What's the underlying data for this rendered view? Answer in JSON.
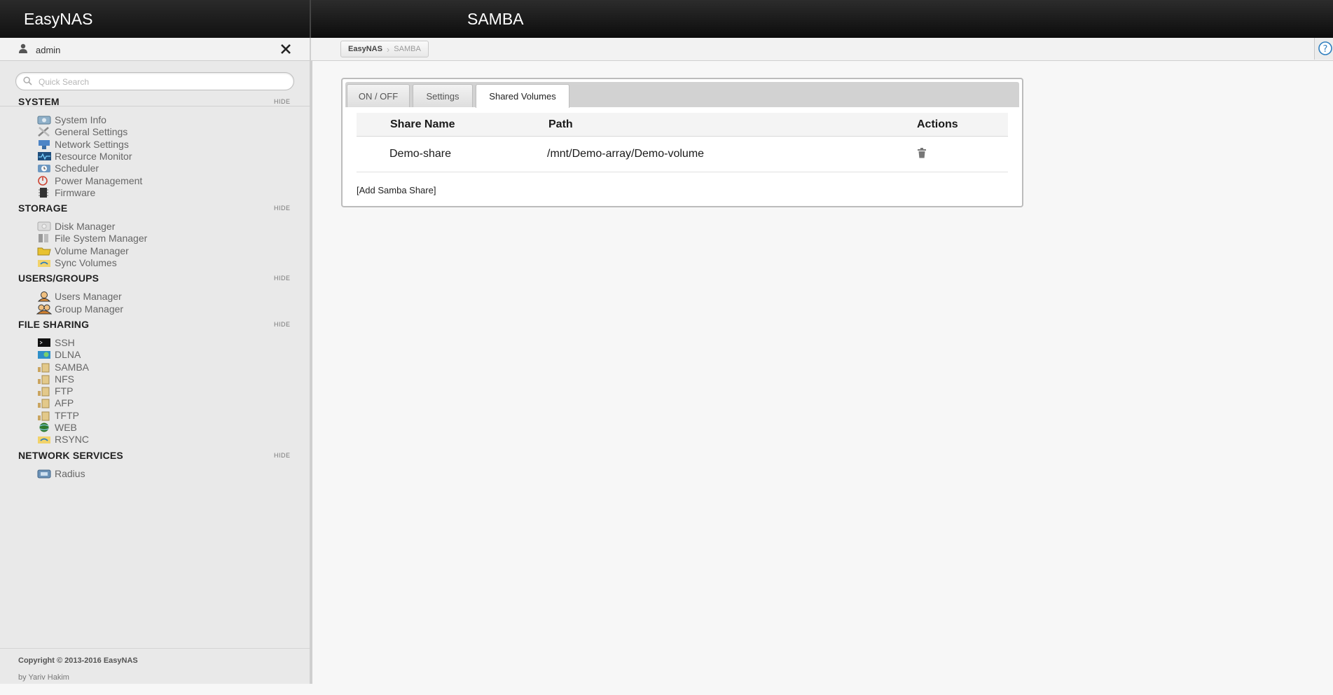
{
  "app": {
    "brand": "EasyNAS",
    "page_title": "SAMBA"
  },
  "user": {
    "name": "admin"
  },
  "search": {
    "placeholder": "Quick Search"
  },
  "sidebar": {
    "hide_label": "HIDE",
    "sections": [
      {
        "title": "SYSTEM",
        "items": [
          {
            "label": "System Info",
            "icon": "system-info-icon"
          },
          {
            "label": "General Settings",
            "icon": "general-settings-icon"
          },
          {
            "label": "Network Settings",
            "icon": "network-settings-icon"
          },
          {
            "label": "Resource Monitor",
            "icon": "resource-monitor-icon"
          },
          {
            "label": "Scheduler",
            "icon": "scheduler-icon"
          },
          {
            "label": "Power Management",
            "icon": "power-icon"
          },
          {
            "label": "Firmware",
            "icon": "firmware-chip-icon"
          }
        ]
      },
      {
        "title": "STORAGE",
        "items": [
          {
            "label": "Disk Manager",
            "icon": "disk-icon"
          },
          {
            "label": "File System Manager",
            "icon": "file-system-icon"
          },
          {
            "label": "Volume Manager",
            "icon": "volume-folder-icon"
          },
          {
            "label": "Sync Volumes",
            "icon": "sync-icon"
          }
        ]
      },
      {
        "title": "USERS/GROUPS",
        "items": [
          {
            "label": "Users Manager",
            "icon": "user-icon"
          },
          {
            "label": "Group Manager",
            "icon": "group-icon"
          }
        ]
      },
      {
        "title": "FILE SHARING",
        "items": [
          {
            "label": "SSH",
            "icon": "terminal-icon"
          },
          {
            "label": "DLNA",
            "icon": "dlna-icon"
          },
          {
            "label": "SAMBA",
            "icon": "share-folder-icon"
          },
          {
            "label": "NFS",
            "icon": "share-folder-icon"
          },
          {
            "label": "FTP",
            "icon": "share-folder-icon"
          },
          {
            "label": "AFP",
            "icon": "share-folder-icon"
          },
          {
            "label": "TFTP",
            "icon": "share-folder-icon"
          },
          {
            "label": "WEB",
            "icon": "globe-icon"
          },
          {
            "label": "RSYNC",
            "icon": "sync-icon"
          }
        ]
      },
      {
        "title": "NETWORK SERVICES",
        "items": [
          {
            "label": "Radius",
            "icon": "radius-icon"
          }
        ]
      }
    ]
  },
  "footer": {
    "copyright": "Copyright © 2013-2016 EasyNAS",
    "byline": "by Yariv Hakim"
  },
  "breadcrumb": [
    "EasyNAS",
    "SAMBA"
  ],
  "tabs": [
    "ON / OFF",
    "Settings",
    "Shared Volumes"
  ],
  "active_tab": "Shared Volumes",
  "table": {
    "headers": [
      "Share Name",
      "Path",
      "Actions"
    ],
    "rows": [
      {
        "name": "Demo-share",
        "path": "/mnt/Demo-array/Demo-volume"
      }
    ]
  },
  "add_link": "[Add Samba Share]",
  "colors": {
    "header_bg": "#111111",
    "sidebar_bg": "#e9e9e9",
    "page_bg": "#f7f7f7"
  }
}
